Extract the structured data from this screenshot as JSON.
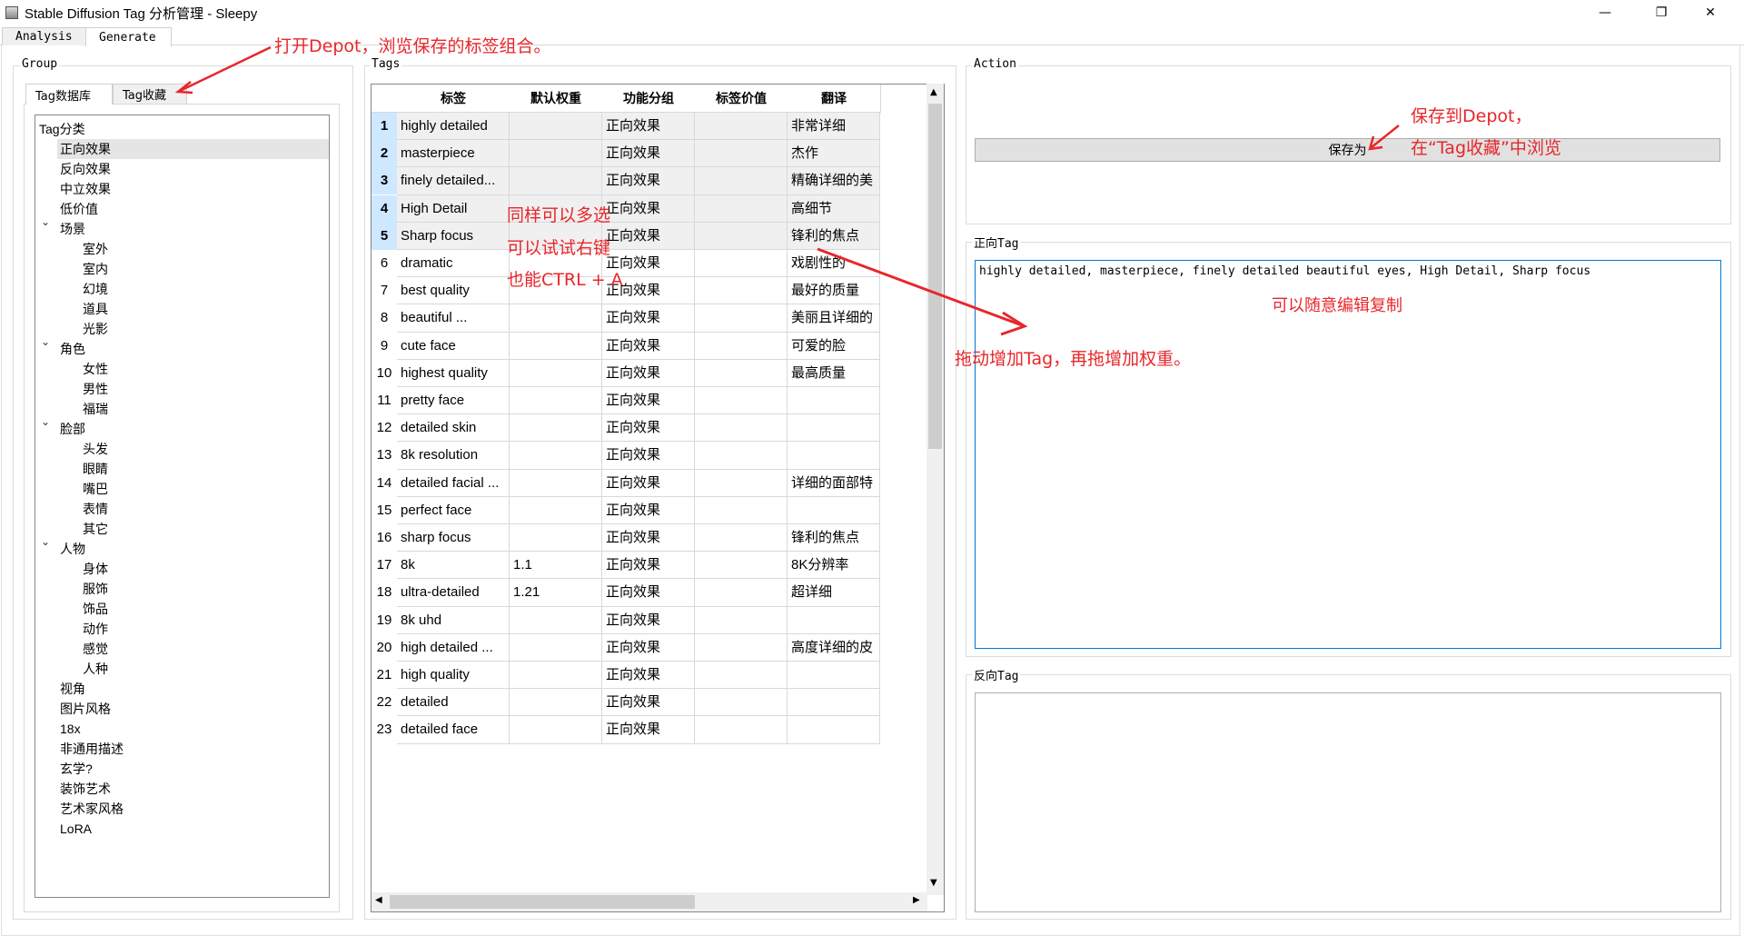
{
  "window": {
    "title": "Stable Diffusion Tag 分析管理 - Sleepy",
    "minimize": "—",
    "maximize": "❐",
    "close": "✕"
  },
  "main_tabs": [
    "Analysis",
    "Generate"
  ],
  "group": {
    "title": "Group",
    "tabs": [
      "Tag数据库",
      "Tag收藏"
    ],
    "tree_root": "Tag分类",
    "tree": [
      {
        "label": "正向效果",
        "level": 1,
        "selected": true
      },
      {
        "label": "反向效果",
        "level": 1
      },
      {
        "label": "中立效果",
        "level": 1
      },
      {
        "label": "低价值",
        "level": 1
      },
      {
        "label": "场景",
        "level": 1,
        "expanded": true
      },
      {
        "label": "室外",
        "level": 2
      },
      {
        "label": "室内",
        "level": 2
      },
      {
        "label": "幻境",
        "level": 2
      },
      {
        "label": "道具",
        "level": 2
      },
      {
        "label": "光影",
        "level": 2
      },
      {
        "label": "角色",
        "level": 1,
        "expanded": true
      },
      {
        "label": "女性",
        "level": 2
      },
      {
        "label": "男性",
        "level": 2
      },
      {
        "label": "福瑞",
        "level": 2
      },
      {
        "label": "脸部",
        "level": 1,
        "expanded": true
      },
      {
        "label": "头发",
        "level": 2
      },
      {
        "label": "眼睛",
        "level": 2
      },
      {
        "label": "嘴巴",
        "level": 2
      },
      {
        "label": "表情",
        "level": 2
      },
      {
        "label": "其它",
        "level": 2
      },
      {
        "label": "人物",
        "level": 1,
        "expanded": true
      },
      {
        "label": "身体",
        "level": 2
      },
      {
        "label": "服饰",
        "level": 2
      },
      {
        "label": "饰品",
        "level": 2
      },
      {
        "label": "动作",
        "level": 2
      },
      {
        "label": "感觉",
        "level": 2
      },
      {
        "label": "人种",
        "level": 2
      },
      {
        "label": "视角",
        "level": 1
      },
      {
        "label": "图片风格",
        "level": 1
      },
      {
        "label": "18x",
        "level": 1
      },
      {
        "label": "非通用描述",
        "level": 1
      },
      {
        "label": "玄学?",
        "level": 1
      },
      {
        "label": "装饰艺术",
        "level": 1
      },
      {
        "label": "艺术家风格",
        "level": 1
      },
      {
        "label": "LoRA",
        "level": 1
      }
    ]
  },
  "tags": {
    "title": "Tags",
    "columns": [
      "标签",
      "默认权重",
      "功能分组",
      "标签价值",
      "翻译"
    ],
    "rows": [
      {
        "n": "1",
        "tag": "highly detailed",
        "w": "",
        "g": "正向效果",
        "v": "",
        "t": "非常详细",
        "sel": true
      },
      {
        "n": "2",
        "tag": "masterpiece",
        "w": "",
        "g": "正向效果",
        "v": "",
        "t": "杰作",
        "sel": true
      },
      {
        "n": "3",
        "tag": "finely detailed...",
        "w": "",
        "g": "正向效果",
        "v": "",
        "t": "精确详细的美",
        "sel": true
      },
      {
        "n": "4",
        "tag": "High Detail",
        "w": "",
        "g": "正向效果",
        "v": "",
        "t": "高细节",
        "sel": true
      },
      {
        "n": "5",
        "tag": "Sharp focus",
        "w": "",
        "g": "正向效果",
        "v": "",
        "t": "锋利的焦点",
        "sel": true
      },
      {
        "n": "6",
        "tag": "dramatic",
        "w": "",
        "g": "正向效果",
        "v": "",
        "t": "戏剧性的"
      },
      {
        "n": "7",
        "tag": "best quality",
        "w": "",
        "g": "正向效果",
        "v": "",
        "t": "最好的质量"
      },
      {
        "n": "8",
        "tag": "beautiful ...",
        "w": "",
        "g": "正向效果",
        "v": "",
        "t": "美丽且详细的"
      },
      {
        "n": "9",
        "tag": "cute face",
        "w": "",
        "g": "正向效果",
        "v": "",
        "t": "可爱的脸"
      },
      {
        "n": "10",
        "tag": "highest quality",
        "w": "",
        "g": "正向效果",
        "v": "",
        "t": "最高质量"
      },
      {
        "n": "11",
        "tag": "pretty face",
        "w": "",
        "g": "正向效果",
        "v": "",
        "t": ""
      },
      {
        "n": "12",
        "tag": "detailed skin",
        "w": "",
        "g": "正向效果",
        "v": "",
        "t": ""
      },
      {
        "n": "13",
        "tag": "8k resolution",
        "w": "",
        "g": "正向效果",
        "v": "",
        "t": ""
      },
      {
        "n": "14",
        "tag": "detailed facial ...",
        "w": "",
        "g": "正向效果",
        "v": "",
        "t": "详细的面部特"
      },
      {
        "n": "15",
        "tag": "perfect face",
        "w": "",
        "g": "正向效果",
        "v": "",
        "t": ""
      },
      {
        "n": "16",
        "tag": "sharp focus",
        "w": "",
        "g": "正向效果",
        "v": "",
        "t": "锋利的焦点"
      },
      {
        "n": "17",
        "tag": "8k",
        "w": "1.1",
        "g": "正向效果",
        "v": "",
        "t": "8K分辨率"
      },
      {
        "n": "18",
        "tag": "ultra-detailed",
        "w": "1.21",
        "g": "正向效果",
        "v": "",
        "t": "超详细"
      },
      {
        "n": "19",
        "tag": "8k uhd",
        "w": "",
        "g": "正向效果",
        "v": "",
        "t": ""
      },
      {
        "n": "20",
        "tag": "high detailed ...",
        "w": "",
        "g": "正向效果",
        "v": "",
        "t": "高度详细的皮"
      },
      {
        "n": "21",
        "tag": "high quality",
        "w": "",
        "g": "正向效果",
        "v": "",
        "t": ""
      },
      {
        "n": "22",
        "tag": "detailed",
        "w": "",
        "g": "正向效果",
        "v": "",
        "t": ""
      },
      {
        "n": "23",
        "tag": "detailed face",
        "w": "",
        "g": "正向效果",
        "v": "",
        "t": ""
      }
    ]
  },
  "action": {
    "title": "Action",
    "save_label": "保存为"
  },
  "positive": {
    "title": "正向Tag",
    "value": "highly detailed, masterpiece, finely detailed beautiful eyes, High Detail, Sharp focus"
  },
  "negative": {
    "title": "反向Tag",
    "value": ""
  },
  "annotations": {
    "depot": "打开Depot，浏览保存的标签组合。",
    "save1": "保存到Depot，",
    "save2": "在“Tag收藏”中浏览",
    "multi1": "同样可以多选",
    "multi2": "可以试试右键",
    "multi3": "也能CTRL + A",
    "edit": "可以随意编辑复制",
    "drag": "拖动增加Tag，再拖增加权重。"
  },
  "colors": {
    "annotation": "#e8262b",
    "selection_header": "#cde8ff",
    "focus_border": "#0078d7"
  }
}
